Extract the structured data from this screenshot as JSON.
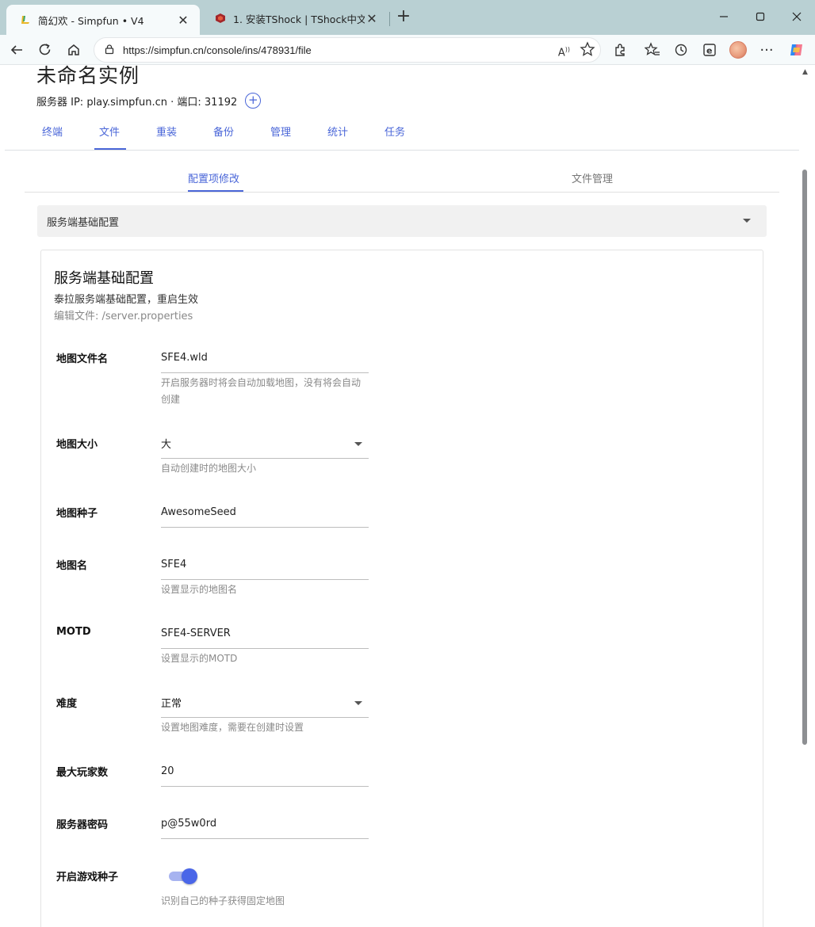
{
  "browser": {
    "tabs": [
      {
        "title": "简幻欢 - Simpfun • V4",
        "active": true
      },
      {
        "title": "1. 安装TShock | TShock中文插件库",
        "active": false
      }
    ],
    "url": "https://simpfun.cn/console/ins/478931/file",
    "icons": [
      "back-icon",
      "refresh-icon",
      "home-icon",
      "lock-icon",
      "read-aloud-icon",
      "favorite-star-icon",
      "extensions-icon",
      "favorites-icon",
      "history-icon",
      "edge-icon",
      "avatar",
      "more-icon",
      "copilot-icon"
    ]
  },
  "instance": {
    "title": "未命名实例",
    "server_ip": "服务器 IP: play.simpfun.cn · 端口: 31192"
  },
  "main_nav": [
    "终端",
    "文件",
    "重装",
    "备份",
    "管理",
    "统计",
    "任务"
  ],
  "main_nav_active": "文件",
  "sub_tabs": [
    "配置项修改",
    "文件管理"
  ],
  "sub_tab_active": "配置项修改",
  "config_select": "服务端基础配置",
  "card": {
    "title": "服务端基础配置",
    "subtitle": "泰拉服务端基础配置，重启生效",
    "file": "编辑文件: /server.properties"
  },
  "fields": [
    {
      "label": "地图文件名",
      "value": "SFE4.wld",
      "hint": "开启服务器时将会自动加载地图，没有将会自动创建"
    },
    {
      "label": "地图大小",
      "value": "大",
      "hint": "自动创建时的地图大小"
    },
    {
      "label": "地图种子",
      "value": "AwesomeSeed",
      "hint": ""
    },
    {
      "label": "地图名",
      "value": "SFE4",
      "hint": "设置显示的地图名"
    },
    {
      "label": "MOTD",
      "value": "SFE4-SERVER",
      "hint": "设置显示的MOTD"
    },
    {
      "label": "难度",
      "value": "正常",
      "hint": "设置地图难度，需要在创建时设置"
    },
    {
      "label": "最大玩家数",
      "value": "20",
      "hint": ""
    },
    {
      "label": "服务器密码",
      "value": "p@55w0rd",
      "hint": ""
    },
    {
      "label": "开启游戏种子",
      "value": "on",
      "hint": "识别自己的种子获得固定地图"
    }
  ],
  "accent_color": "#4a66d8"
}
